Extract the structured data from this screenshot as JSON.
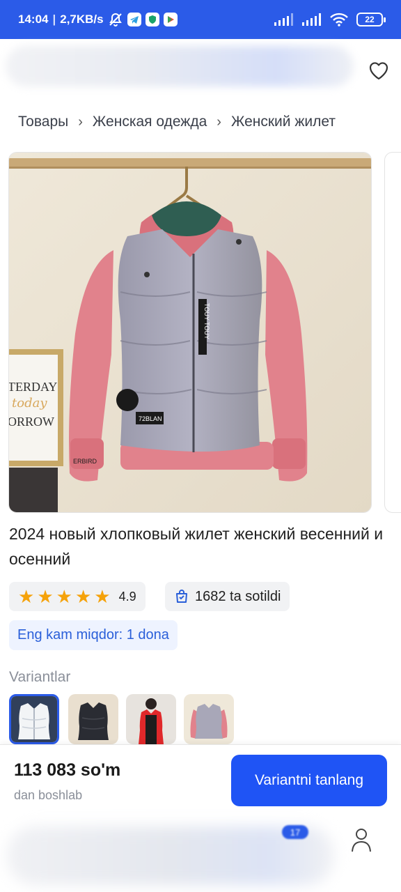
{
  "status_bar": {
    "time": "14:04",
    "network_speed": "2,7KB/s",
    "battery": "22",
    "icons": [
      "mute-bell-icon",
      "telegram-icon",
      "vpn-shield-icon",
      "play-store-icon",
      "signal-icon",
      "signal-icon",
      "wifi-icon",
      "battery-icon"
    ]
  },
  "header": {
    "search_icon": "blurred-search-bar",
    "favorite_icon": "heart-icon"
  },
  "breadcrumb": [
    "Товары",
    "Женская одежда",
    "Женский жилет"
  ],
  "product": {
    "title": "2024 новый хлопковый жилет женский весенний и осенний",
    "rating": "4.9",
    "stars": 5,
    "sold": "1682 ta sotildi",
    "min_order": "Eng kam miqdor: 1 dona",
    "photo_text": {
      "poster_line1": "TERDAY",
      "poster_line2": "today",
      "poster_line3": "ORROW",
      "patch": "72BLAN",
      "strap": "TOUY TOUY",
      "cuff": "ERBIRD"
    }
  },
  "variants": {
    "label": "Variantlar",
    "items": [
      {
        "color": "white",
        "selected": true
      },
      {
        "color": "black",
        "selected": false
      },
      {
        "color": "red",
        "selected": false
      },
      {
        "color": "grey-pink",
        "selected": false
      }
    ]
  },
  "purchase_bar": {
    "price": "113 083 so'm",
    "price_sub": "dan boshlab",
    "button": "Variantni tanlang"
  },
  "nav": {
    "cart_badge": "17",
    "profile_icon": "profile-icon"
  },
  "colors": {
    "accent": "#1f54f5",
    "status_bar": "#2b5be8",
    "star": "#f5a20a",
    "chip_bg": "#f1f2f4",
    "min_order_text": "#2a5fd9"
  }
}
